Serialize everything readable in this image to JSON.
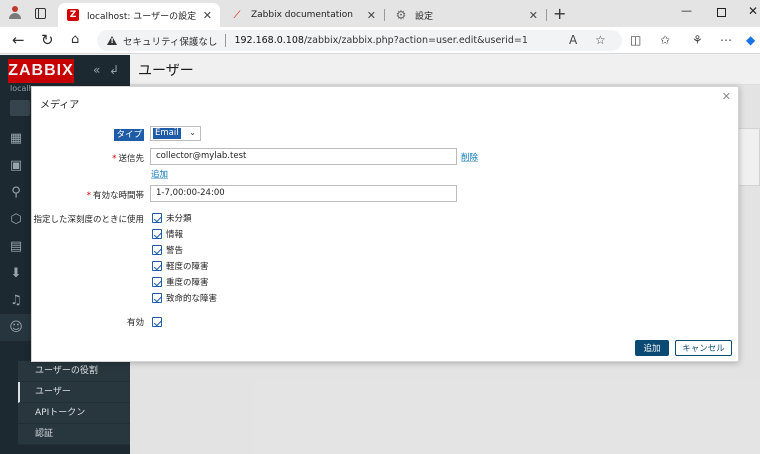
{
  "browser": {
    "tabs": [
      {
        "title": "localhost: ユーザーの設定",
        "icon": "zabbix-favicon"
      },
      {
        "title": "Zabbix documentation",
        "icon": "zabbix-doc-favicon"
      },
      {
        "title": "設定",
        "icon": "gear-icon"
      }
    ],
    "address": {
      "security_text": "セキュリティ保護なし",
      "host": "192.168.0.108",
      "path": "/zabbix/zabbix.php?action=user.edit&userid=1"
    }
  },
  "app": {
    "logo": "ZABBIX",
    "server_name": "localh",
    "page_title": "ユーザー",
    "submenu": [
      "ユーザーの役割",
      "ユーザー",
      "APIトークン",
      "認証"
    ],
    "selected_submenu": "ユーザー"
  },
  "modal": {
    "title": "メディア",
    "type_label": "タイプ",
    "type_value": "Email",
    "sendto_label": "送信先",
    "sendto_value": "collector@mylab.test",
    "remove_link": "削除",
    "add_link": "追加",
    "period_label": "有効な時間帯",
    "period_value": "1-7,00:00-24:00",
    "severity_label": "指定した深刻度のときに使用",
    "severities": [
      {
        "label": "未分類",
        "checked": true
      },
      {
        "label": "情報",
        "checked": true
      },
      {
        "label": "警告",
        "checked": true
      },
      {
        "label": "軽度の障害",
        "checked": true
      },
      {
        "label": "重度の障害",
        "checked": true
      },
      {
        "label": "致命的な障害",
        "checked": true
      }
    ],
    "enabled_label": "有効",
    "enabled": true,
    "add_button": "追加",
    "cancel_button": "キャンセル"
  },
  "colors": {
    "brand": "#d40000",
    "sidebar_bg": "#1f2c33",
    "primary_button": "#0b4a74",
    "link": "#0275b8",
    "selection": "#1f5ca8"
  }
}
